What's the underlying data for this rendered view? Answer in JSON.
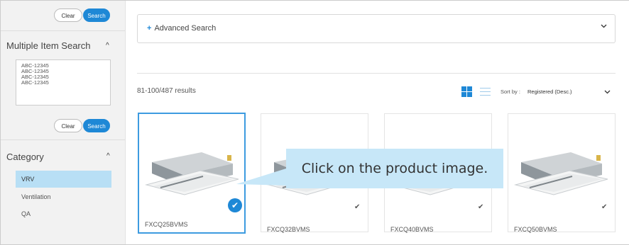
{
  "sidebar": {
    "top_clear": "Clear",
    "top_search": "Search",
    "multi_title": "Multiple Item Search",
    "multi_lines": [
      "ABC-12345",
      "ABC-12345",
      "ABC-12345",
      "ABC-12345"
    ],
    "multi_clear": "Clear",
    "multi_search": "Search",
    "category_title": "Category",
    "categories": [
      {
        "label": "VRV",
        "active": true
      },
      {
        "label": "Ventilation",
        "active": false
      },
      {
        "label": "QA",
        "active": false
      }
    ]
  },
  "main": {
    "advanced_search_label": "Advanced Search",
    "results_text": "81-100/487 results",
    "sort_label": "Sort by :",
    "sort_value": "Registered (Desc.)",
    "view_mode": "grid",
    "products": [
      {
        "name": "FXCQ25BVMS",
        "selected": true
      },
      {
        "name": "FXCQ32BVMS",
        "selected": false
      },
      {
        "name": "FXCQ40BVMS",
        "selected": false
      },
      {
        "name": "FXCQ50BVMS",
        "selected": false
      }
    ],
    "tooltip_text": "Click on the product image."
  },
  "colors": {
    "accent": "#1e88d6",
    "active_category_bg": "#b8dff5",
    "tooltip_bg": "#c7e7f8",
    "sidebar_bg": "#f2f2f2"
  },
  "icons": [
    "plus-icon",
    "chevron-down-icon",
    "chevron-up-icon",
    "grid-view-icon",
    "list-view-icon",
    "checkmark-icon"
  ]
}
